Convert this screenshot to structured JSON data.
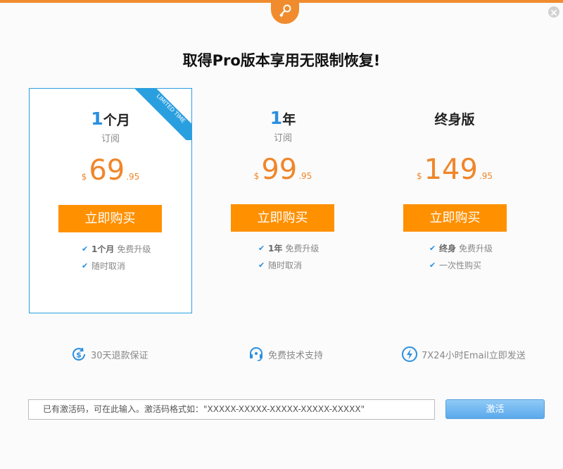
{
  "header": {
    "accent_color": "#f08c2e",
    "badge_icon": "key-icon",
    "close_icon": "close-icon"
  },
  "headline": "取得Pro版本享用无限制恢复!",
  "plans": [
    {
      "title_num": "1",
      "title_unit": "个月",
      "subtitle": "订阅",
      "currency": "$",
      "price_int": "69",
      "price_dec": ".95",
      "buy_label": "立即购买",
      "ribbon": "LIMITED TIME",
      "features": [
        {
          "bold": "1个月",
          "text": "免费升级"
        },
        {
          "bold": "",
          "text": "随时取消"
        }
      ]
    },
    {
      "title_num": "1",
      "title_unit": "年",
      "subtitle": "订阅",
      "currency": "$",
      "price_int": "99",
      "price_dec": ".95",
      "buy_label": "立即购买",
      "features": [
        {
          "bold": "1年",
          "text": "免费升级"
        },
        {
          "bold": "",
          "text": "随时取消"
        }
      ]
    },
    {
      "title_num": "",
      "title_unit": "终身版",
      "subtitle": "",
      "currency": "$",
      "price_int": "149",
      "price_dec": ".95",
      "buy_label": "立即购买",
      "features": [
        {
          "bold": "终身",
          "text": "免费升级"
        },
        {
          "bold": "",
          "text": "一次性购买"
        }
      ]
    }
  ],
  "guarantees": [
    {
      "icon": "refund-dollar-icon",
      "label": "30天退款保证"
    },
    {
      "icon": "headset-support-icon",
      "label": "免费技术支持"
    },
    {
      "icon": "lightning-icon",
      "label": "7X24小时Email立即发送"
    }
  ],
  "activation": {
    "placeholder": "已有激活码，可在此输入。激活码格式如：\"XXXXX-XXXXX-XXXXX-XXXXX-XXXXX\"",
    "button_label": "激活"
  },
  "colors": {
    "brand_orange": "#ff9000",
    "price_orange": "#f0862a",
    "accent_blue": "#2a9fe0"
  }
}
